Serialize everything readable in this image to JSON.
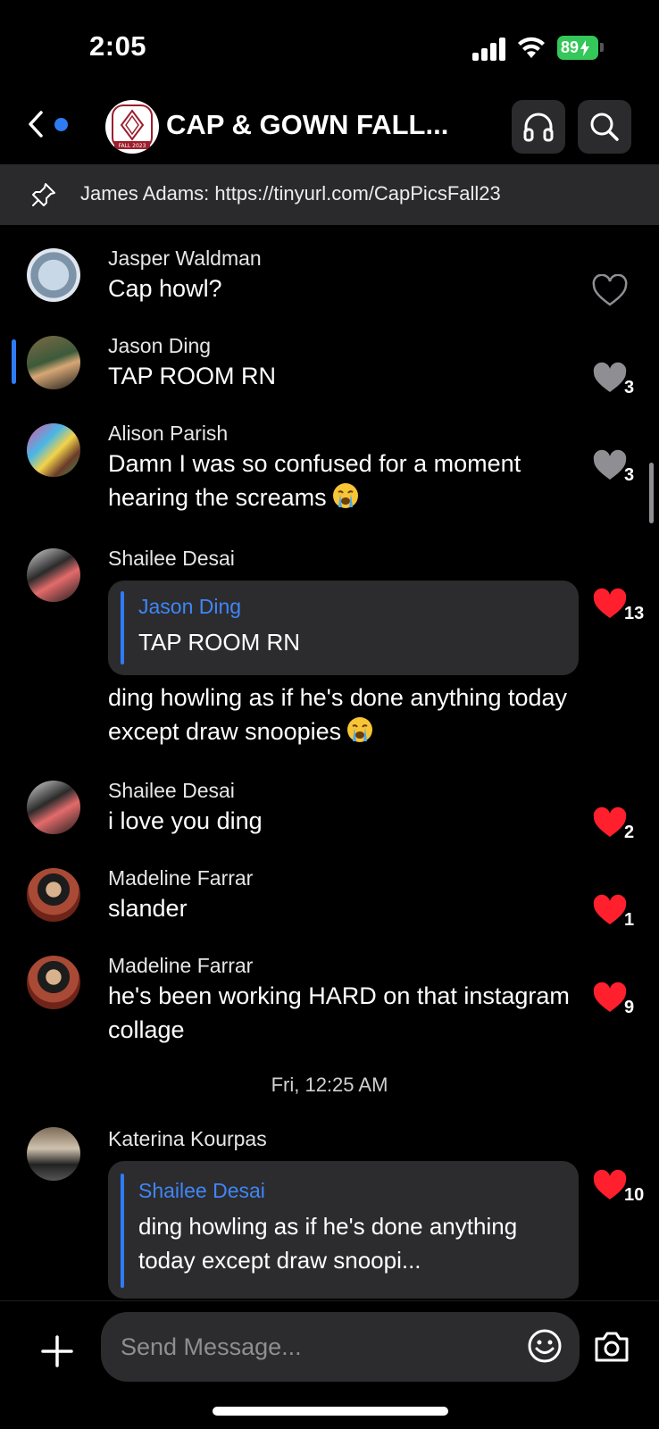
{
  "status_bar": {
    "time": "2:05",
    "battery": "89"
  },
  "header": {
    "title": "CAP & GOWN FALL...",
    "avatar_text": "FALL 2023"
  },
  "pinned": {
    "text": "James Adams: https://tinyurl.com/CapPicsFall23"
  },
  "messages": [
    {
      "sender": "Jasper Waldman",
      "text": "Cap howl?",
      "likes": ""
    },
    {
      "sender": "Jason Ding",
      "text": "TAP ROOM RN",
      "likes": "3"
    },
    {
      "sender": "Alison Parish",
      "text": "Damn I was so confused for a moment hearing the screams",
      "likes": "3"
    },
    {
      "sender": "Shailee Desai",
      "reply_to": "Jason Ding",
      "reply_text": "TAP ROOM RN",
      "text": "ding howling as if he's done anything today except draw snoopies",
      "likes": "13"
    },
    {
      "sender": "Shailee Desai",
      "text": "i love you ding",
      "likes": "2"
    },
    {
      "sender": "Madeline Farrar",
      "text": "slander",
      "likes": "1"
    },
    {
      "sender": "Madeline Farrar",
      "text": "he's been working HARD on that instagram collage",
      "likes": "9"
    },
    {
      "sender": "Katerina Kourpas",
      "reply_to": "Shailee Desai",
      "reply_text": "ding howling as if he's done anything today except draw snoopi...",
      "likes": "10"
    }
  ],
  "timestamp": "Fri, 12:25 AM",
  "composer": {
    "placeholder": "Send Message..."
  },
  "colors": {
    "accent": "#2f7bf5",
    "like_red": "#ff1f2d",
    "like_gray": "#8e8e93"
  }
}
